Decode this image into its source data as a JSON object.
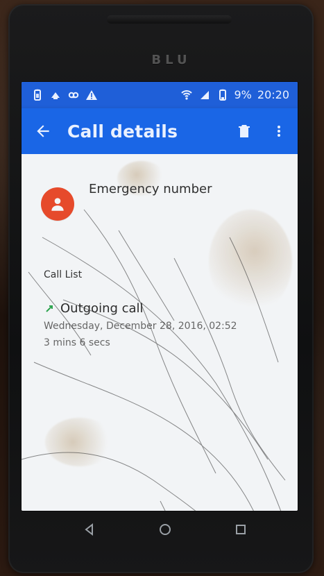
{
  "device": {
    "brand": "BLU"
  },
  "status_bar": {
    "battery_percent_text": "9%",
    "time": "20:20",
    "icons_left": [
      "battery-saver-icon",
      "notification-icon",
      "voicemail-icon",
      "warning-icon"
    ],
    "icons_right": [
      "wifi-icon",
      "cell-signal-icon",
      "battery-icon"
    ],
    "colors": {
      "bar": "#1f5fd8",
      "icon": "#eaf1ff"
    }
  },
  "app_bar": {
    "title": "Call details",
    "icons": [
      "back-arrow-icon",
      "trash-icon",
      "more-vert-icon"
    ],
    "color": "#1a66e6"
  },
  "contact": {
    "name": "Emergency number",
    "avatar_color": "#e64a2b"
  },
  "call_list": {
    "title": "Call List",
    "items": [
      {
        "type": "Outgoing call",
        "date": "Wednesday, December 28, 2016, 02:52",
        "duration": "3 mins 6 secs",
        "icon": "outgoing-call-icon",
        "icon_color": "#2ea44f"
      }
    ]
  },
  "navigation_bar": {
    "buttons": [
      "back-triangle-icon",
      "home-circle-icon",
      "recents-square-icon"
    ]
  }
}
